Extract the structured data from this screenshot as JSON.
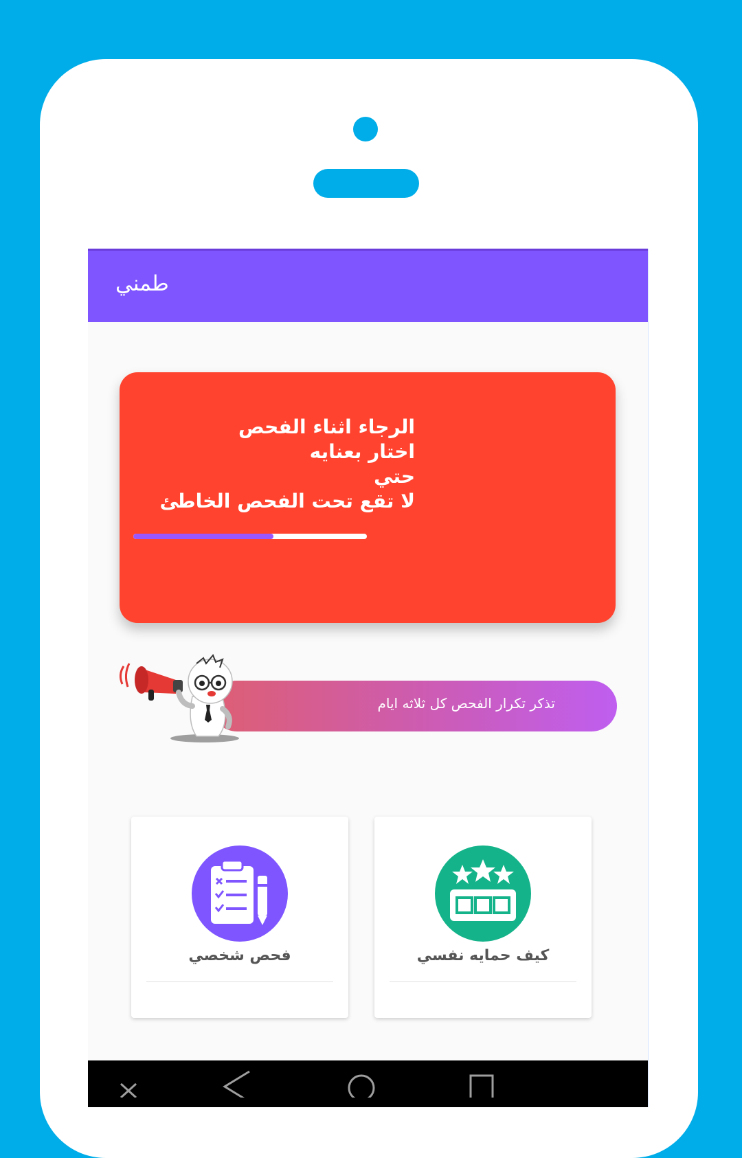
{
  "app": {
    "title": "طمني"
  },
  "notice": {
    "lines": [
      "الرجاء اثناء الفحص",
      "اختار بعنايه",
      "حتي",
      "لا تقع تحت الفحص الخاطئ"
    ],
    "progress_fraction": 0.6
  },
  "reminder": {
    "text": "تذكر تكرار الفحص كل ثلاثه ايام"
  },
  "menu": {
    "items": [
      {
        "label": "فحص شخصي",
        "icon": "clipboard-checklist-icon",
        "color": "#7e55ff"
      },
      {
        "label": "كيف حمايه نفسي",
        "icon": "stars-rating-icon",
        "color": "#14b389"
      }
    ]
  },
  "navbar": {
    "buttons": [
      "close-icon",
      "back-icon",
      "home-icon",
      "recents-icon"
    ]
  },
  "colors": {
    "background": "#00ade8",
    "appbar": "#7e55ff",
    "notice_card": "#ff432e",
    "reminder_gradient": [
      "#dd5e73",
      "#bf5ef0"
    ]
  }
}
